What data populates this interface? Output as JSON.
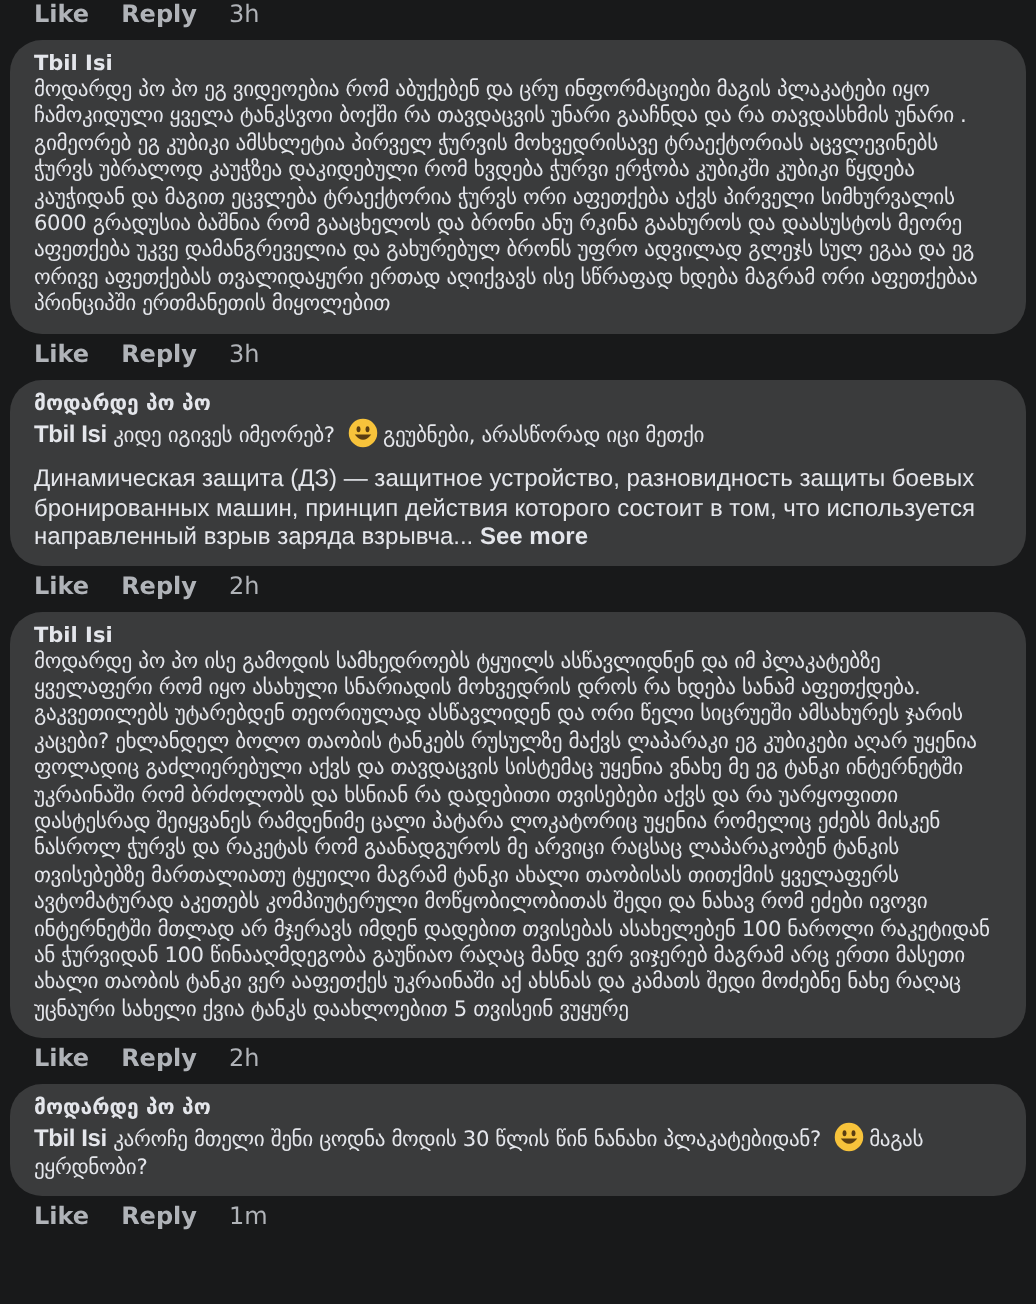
{
  "previous_actions": {
    "like": "Like",
    "reply": "Reply",
    "time": "3h"
  },
  "comments": [
    {
      "author": "Tbil Isi",
      "body": [
        {
          "kind": "text",
          "text": "მოდარდე პო პო ეგ ვიდეოებია რომ აბუქებენ და ცრუ ინფორმაციები მაგის პლაკატები იყო ჩამოკიდული ყველა ტანკსვოი ბოქში რა თავდაცვის უნარი გააჩნდა და რა თავდასხმის უნარი . გიმეორებ ეგ კუბიკი ამსხლეტია პირველ ჭურვის მოხვედრისავე ტრაექტორიას აცვლევინებს ჭურვს უბრალოდ კაუჭზეა დაკიდებული რომ ხვდება ჭურვი ერჭობა კუბიკში კუბიკი წყდება კაუჭიდან და მაგით ეცვლება ტრაექტორია ჭურვს ორი აფეთქება აქვს პირველი სიმხურვალის 6000 გრადუსია ბაშნია რომ გააცხელოს და ბრონი ანუ რკინა გაახუროს და დაასუსტოს მეორე აფეთქება უკვე დამანგრეველია და გახურებულ ბრონს უფრო ადვილად გლეჯს სულ ეგაა და ეგ ორივე აფეთქებას თვალიდაყური ერთად აღიქვავს ისე სწრაფად ხდება მაგრამ ორი აფეთქებაა პრინციპში ერთმანეთის მიყოლებით"
        }
      ],
      "actions": {
        "like": "Like",
        "reply": "Reply",
        "time": "3h"
      }
    },
    {
      "author": "მოდარდე პო პო",
      "body": [
        {
          "kind": "mention",
          "text": "Tbil Isi"
        },
        {
          "kind": "text",
          "text": "კიდე იგივეს იმეორებ?"
        },
        {
          "kind": "emoji"
        },
        {
          "kind": "text",
          "text": "გეუბნები, არასწორად იცი მეთქი"
        }
      ],
      "quote": {
        "text": "Динамическая защита (ДЗ) — защитное устройство, разновидность защиты боевых бронированных машин, принцип действия которого состоит в том, что используется направленный взрыв заряда взрывча...",
        "see_more": "See more"
      },
      "actions": {
        "like": "Like",
        "reply": "Reply",
        "time": "2h"
      }
    },
    {
      "author": "Tbil Isi",
      "body": [
        {
          "kind": "text",
          "text": "მოდარდე პო პო ისე გამოდის სამხედროებს ტყუილს ასწავლიდნენ და იმ პლაკატებზე ყველაფერი რომ იყო ასახული სნარიადის მოხვედრის დროს რა ხდება სანამ აფეთქდება. გაკვეთილებს უტარებდენ თეორიულად ასწავლიდენ და ორი წელი სიცრუეში ამსახურეს ჯარის კაცები? ეხლანდელ ბოლო თაობის ტანკებს რუსულზე მაქვს ლაპარაკი ეგ კუბიკები აღარ უყენია ფოლადიც გაძლიერებული აქვს და თავდაცვის სისტემაც უყენია ვნახე მე ეგ ტანკი ინტერნეტში უკრაინაში რომ ბრძოლობს და ხსნიან რა დადებითი თვისებები აქვს და რა უარყოფითი დასტესრად შეიყვანეს რამდენიმე ცალი პატარა ლოკატორიც უყენია რომელიც ეძებს მისკენ ნასროლ ჭურვს და რაკეტას რომ გაანადგუროს მე არვიცი რაცსაც ლაპარაკობენ ტანკის თვისებებზე მართალიათუ ტყუილი მაგრამ ტანკი ახალი თაობისას თითქმის ყველაფერს ავტომატურად აკეთებს კომპიუტერული მოწყობილობითას შედი და ნახავ რომ ეძები ივოვი ინტერნეტში მთლად არ მჯერავს იმდენ დადებით თვისებას ასახელებენ 100 ნაროლი რაკეტიდან ან ჭურვიდან 100 წინააღმდეგობა გაუწიაო რაღაც მანდ ვერ ვიჯერებ მაგრამ არც ერთი მასეთი ახალი თაობის ტანკი ვერ ააფეთქეს უკრაინაში აქ ახსნას და კამათს შედი მოძებნე ნახე რაღაც უცნაური სახელი ქვია ტანკს დაახლოებით 5 თვისეინ ვუყურე"
        }
      ],
      "actions": {
        "like": "Like",
        "reply": "Reply",
        "time": "2h"
      }
    },
    {
      "author": "მოდარდე პო პო",
      "body": [
        {
          "kind": "mention",
          "text": "Tbil Isi"
        },
        {
          "kind": "text",
          "text": "კაროჩე მთელი შენი ცოდნა მოდის 30 წლის წინ ნანახი პლაკატებიდან?"
        },
        {
          "kind": "emoji"
        },
        {
          "kind": "text",
          "text": "მაგას ეყრდნობი?"
        }
      ],
      "actions": {
        "like": "Like",
        "reply": "Reply",
        "time": "1m"
      }
    }
  ]
}
